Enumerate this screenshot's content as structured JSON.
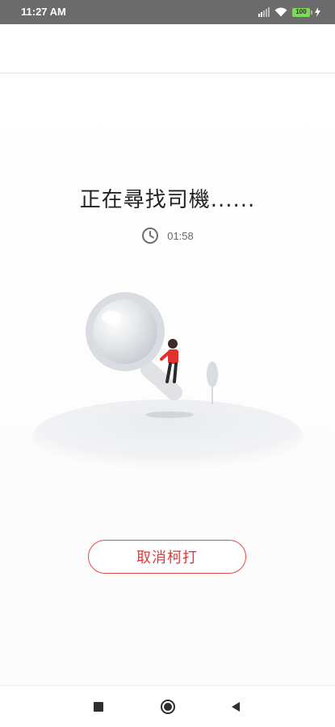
{
  "status_bar": {
    "time": "11:27 AM",
    "battery": "100"
  },
  "search": {
    "title": "正在尋找司機......",
    "elapsed": "01:58"
  },
  "actions": {
    "cancel_label": "取消柯打"
  },
  "icons": {
    "signal": "signal-icon",
    "wifi": "wifi-icon",
    "battery": "battery-icon",
    "charging": "charging-icon",
    "clock": "clock-icon",
    "nav_recents": "square-icon",
    "nav_home": "circle-icon",
    "nav_back": "triangle-back-icon"
  },
  "colors": {
    "accent": "#e03a3a",
    "status_bar": "#6b6b6b",
    "battery": "#7ed957"
  }
}
